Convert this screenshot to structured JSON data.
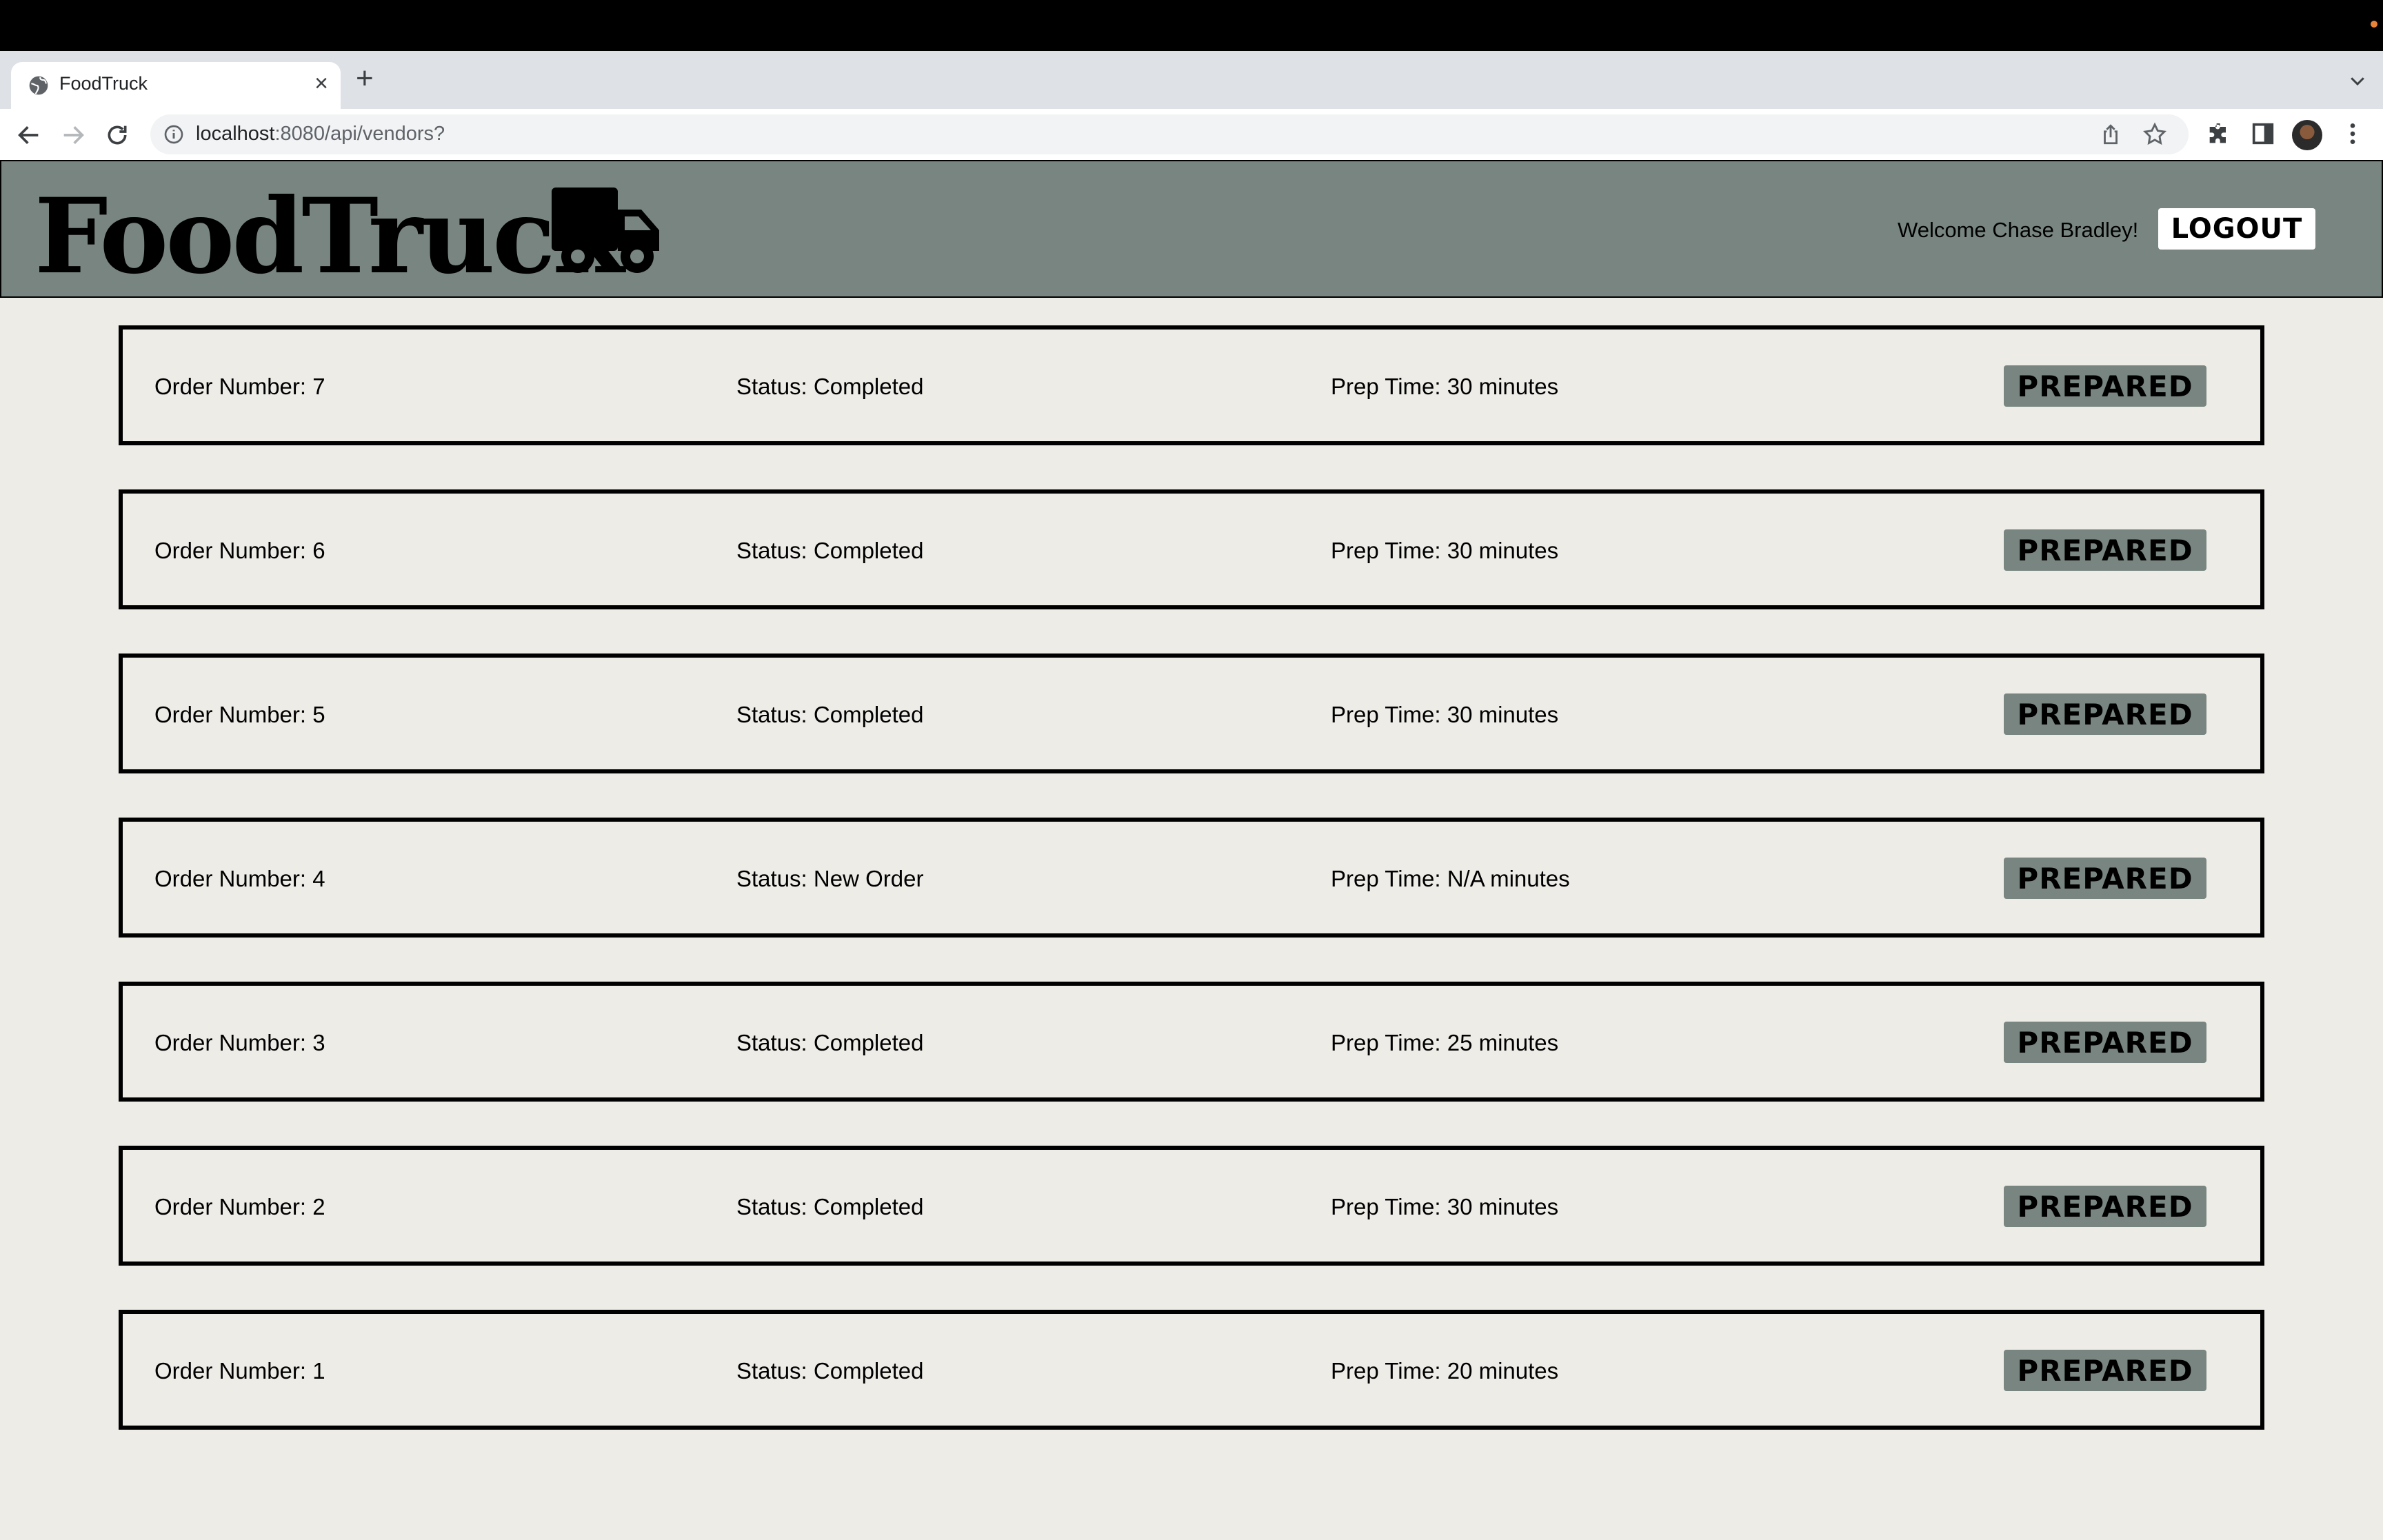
{
  "browser": {
    "tab_title": "FoodTruck",
    "tab_close": "×",
    "new_tab": "+",
    "url_host": "localhost",
    "url_path": ":8080/api/vendors?"
  },
  "header": {
    "brand": "FoodTruck",
    "welcome": "Welcome Chase Bradley!",
    "logout_label": "LOGOUT",
    "background_color": "#788580"
  },
  "orders": [
    {
      "number": "Order Number: 7",
      "status": "Status: Completed",
      "prep": "Prep Time: 30 minutes",
      "action": "PREPARED"
    },
    {
      "number": "Order Number: 6",
      "status": "Status: Completed",
      "prep": "Prep Time: 30 minutes",
      "action": "PREPARED"
    },
    {
      "number": "Order Number: 5",
      "status": "Status: Completed",
      "prep": "Prep Time: 30 minutes",
      "action": "PREPARED"
    },
    {
      "number": "Order Number: 4",
      "status": "Status: New Order",
      "prep": "Prep Time: N/A minutes",
      "action": "PREPARED"
    },
    {
      "number": "Order Number: 3",
      "status": "Status: Completed",
      "prep": "Prep Time: 25 minutes",
      "action": "PREPARED"
    },
    {
      "number": "Order Number: 2",
      "status": "Status: Completed",
      "prep": "Prep Time: 30 minutes",
      "action": "PREPARED"
    },
    {
      "number": "Order Number: 1",
      "status": "Status: Completed",
      "prep": "Prep Time: 20 minutes",
      "action": "PREPARED"
    }
  ]
}
